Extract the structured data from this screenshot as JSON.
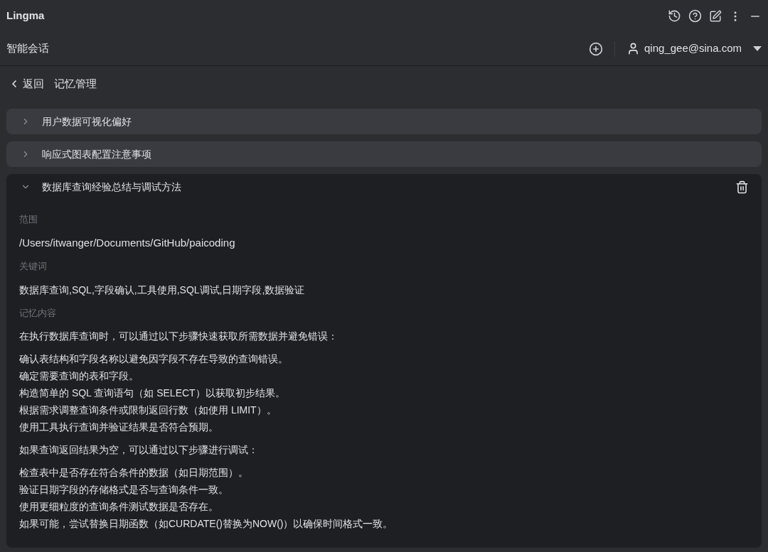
{
  "app": {
    "title": "Lingma"
  },
  "header": {
    "title": "智能会话",
    "user": "qing_gee@sina.com"
  },
  "nav": {
    "back": "返回",
    "title": "记忆管理"
  },
  "memories": [
    {
      "title": "用户数据可视化偏好",
      "expanded": false
    },
    {
      "title": "响应式图表配置注意事项",
      "expanded": false
    },
    {
      "title": "数据库查询经验总结与调试方法",
      "expanded": true,
      "fields": [
        {
          "label": "范围",
          "value": "/Users/itwanger/Documents/GitHub/paicoding"
        },
        {
          "label": "关键词",
          "value": "数据库查询,SQL,字段确认,工具使用,SQL调试,日期字段,数据验证"
        }
      ],
      "content_label": "记忆内容",
      "blocks": [
        [
          "在执行数据库查询时，可以通过以下步骤快速获取所需数据并避免错误："
        ],
        [
          "确认表结构和字段名称以避免因字段不存在导致的查询错误。",
          "确定需要查询的表和字段。",
          "构造简单的 SQL 查询语句（如 SELECT）以获取初步结果。",
          "根据需求调整查询条件或限制返回行数（如使用 LIMIT）。",
          "使用工具执行查询并验证结果是否符合预期。"
        ],
        [
          "如果查询返回结果为空，可以通过以下步骤进行调试："
        ],
        [
          "检查表中是否存在符合条件的数据（如日期范围）。",
          "验证日期字段的存储格式是否与查询条件一致。",
          "使用更细粒度的查询条件测试数据是否存在。",
          "如果可能，尝试替换日期函数（如CURDATE()替换为NOW()）以确保时间格式一致。"
        ]
      ]
    }
  ]
}
